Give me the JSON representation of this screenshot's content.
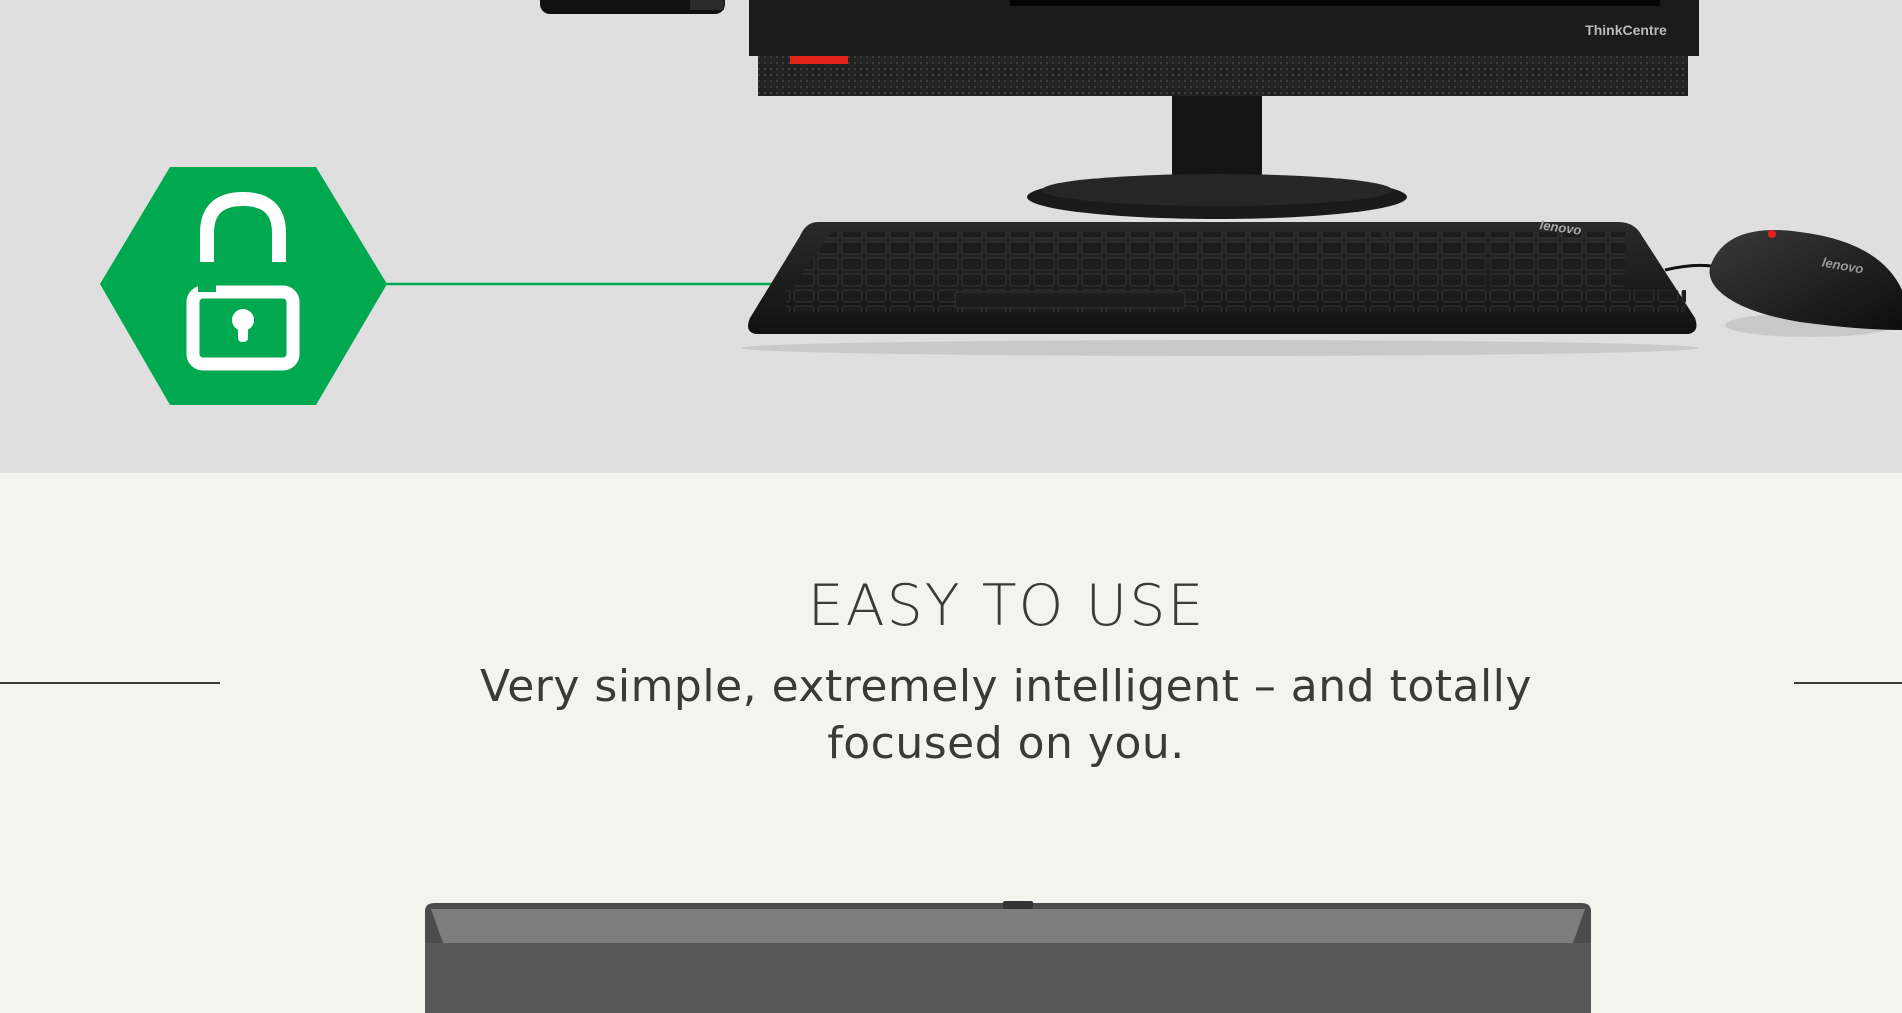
{
  "feature": {
    "title": "EASY TO USE",
    "subtitle": "Very simple, extremely intelligent – and totally focused on you."
  },
  "hero": {
    "monitor_brand": "ThinkCentre",
    "keyboard_brand": "lenovo",
    "mouse_brand": "lenovo"
  },
  "icons": {
    "badge": "unlocked-padlock-icon"
  },
  "colors": {
    "accent_green": "#00a94f",
    "hero_background": "#dfdfdf",
    "section_background": "#f4f4ef",
    "text": "#3b3b35",
    "device_red": "#e2231a"
  }
}
